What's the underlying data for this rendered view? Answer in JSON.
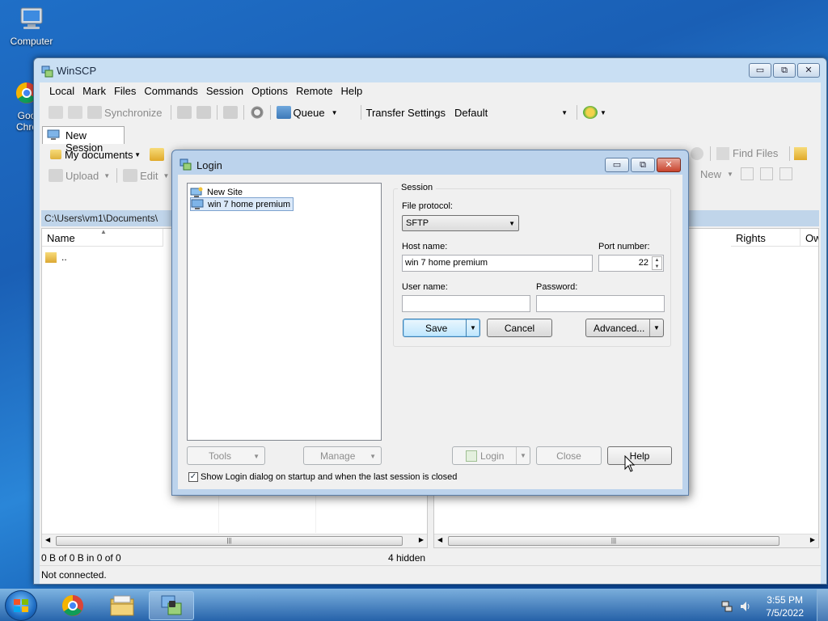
{
  "desktop": {
    "icons": [
      {
        "label": "Computer"
      },
      {
        "label": "Goo Chro"
      }
    ]
  },
  "window": {
    "title": "WinSCP",
    "caption_buttons": {
      "minimize": "▭",
      "restore": "⧉",
      "close": "✕"
    },
    "menu": [
      "Local",
      "Mark",
      "Files",
      "Commands",
      "Session",
      "Options",
      "Remote",
      "Help"
    ],
    "toolbar1": {
      "synchronize": "Synchronize",
      "queue": "Queue",
      "transfer_settings_label": "Transfer Settings",
      "transfer_settings_value": "Default"
    },
    "session_tab": "New Session",
    "local_toolbar": {
      "location": "My documents",
      "upload": "Upload",
      "edit": "Edit"
    },
    "remote_toolbar": {
      "find_files": "Find Files",
      "new": "New"
    },
    "local_path": "C:\\Users\\vm1\\Documents\\",
    "local_columns": [
      "Name"
    ],
    "local_files": [
      ".."
    ],
    "remote_columns": [
      "Rights",
      "Own"
    ],
    "status_left": "0 B of 0 B in 0 of 0",
    "status_hidden": "4 hidden",
    "status_connection": "Not connected."
  },
  "login": {
    "title": "Login",
    "sites": [
      "New Site",
      "win 7 home premium"
    ],
    "selected_site": "win 7 home premium",
    "session_group": "Session",
    "file_protocol_label": "File protocol:",
    "file_protocol_value": "SFTP",
    "host_name_label": "Host name:",
    "host_name_value": "win 7 home premium",
    "port_label": "Port number:",
    "port_value": "22",
    "user_name_label": "User name:",
    "user_name_value": "",
    "password_label": "Password:",
    "password_value": "",
    "buttons": {
      "save": "Save",
      "cancel": "Cancel",
      "advanced": "Advanced...",
      "tools": "Tools",
      "manage": "Manage",
      "login": "Login",
      "close": "Close",
      "help": "Help"
    },
    "show_login_checkbox": "Show Login dialog on startup and when the last session is closed",
    "show_login_checked": true
  },
  "taskbar": {
    "time": "3:55 PM",
    "date": "7/5/2022"
  },
  "colors": {
    "selection": "#dbe9f9",
    "accent": "#3c7fb1"
  }
}
